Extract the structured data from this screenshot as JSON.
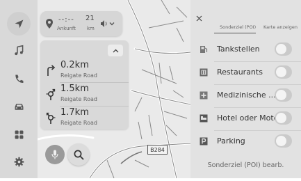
{
  "route": {
    "eta_value": "--:--",
    "eta_label": "Ankunft",
    "distance_value": "21",
    "distance_unit": "km"
  },
  "turns": [
    {
      "distance": "0.2km",
      "road": "Reigate Road",
      "icon": "turn-right-icon"
    },
    {
      "distance": "1.5km",
      "road": "Reigate Road",
      "icon": "roundabout-icon"
    },
    {
      "distance": "1.7km",
      "road": "Reigate Road",
      "icon": "roundabout-icon"
    }
  ],
  "map": {
    "road_badge": "B284"
  },
  "rail": {
    "items": [
      "navigation-icon",
      "music-icon",
      "phone-icon",
      "car-icon",
      "apps-icon",
      "settings-icon"
    ]
  },
  "panel": {
    "tab_poi": "Sonderziel (POI)",
    "tab_map": "Karte anzeigen",
    "items": [
      {
        "label": "Tankstellen",
        "icon": "gas-station-icon",
        "enabled": false
      },
      {
        "label": "Restaurants",
        "icon": "restaurant-icon",
        "enabled": false
      },
      {
        "label": "Medizinische ...",
        "icon": "medical-icon",
        "enabled": false
      },
      {
        "label": "Hotel oder Motel",
        "icon": "hotel-icon",
        "enabled": false
      },
      {
        "label": "Parking",
        "icon": "parking-icon",
        "enabled": false
      }
    ],
    "edit_label": "Sonderziel (POI) bearb."
  }
}
